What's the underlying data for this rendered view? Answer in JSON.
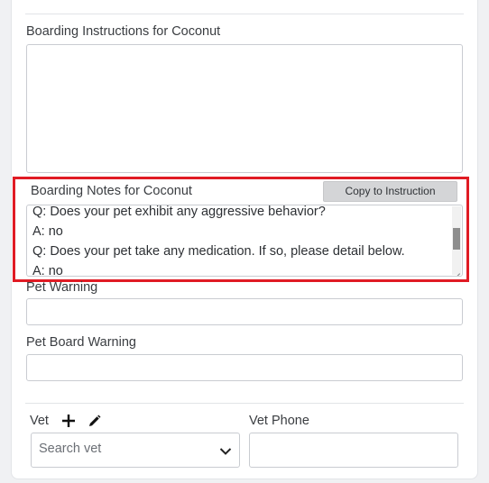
{
  "boarding_instructions": {
    "label": "Boarding Instructions for Coconut",
    "value": ""
  },
  "boarding_notes": {
    "label": "Boarding Notes for Coconut",
    "copy_button": "Copy to Instruction",
    "lines": [
      "Q: Does your pet exhibit any aggressive behavior?",
      "A: no",
      "Q: Does your pet take any medication. If so, please detail below.",
      "A: no"
    ],
    "scroll_position": 0.35
  },
  "pet_warning": {
    "label": "Pet Warning",
    "value": ""
  },
  "pet_board_warning": {
    "label": "Pet Board Warning",
    "value": ""
  },
  "vet": {
    "label": "Vet",
    "placeholder": "Search vet",
    "add_icon": "plus-icon",
    "edit_icon": "pencil-icon",
    "dropdown_icon": "chevron-down-icon"
  },
  "vet_phone": {
    "label": "Vet Phone",
    "value": ""
  },
  "colors": {
    "highlight": "#e01b24",
    "border": "#c9ccd1",
    "button_bg": "#d4d5d7"
  }
}
